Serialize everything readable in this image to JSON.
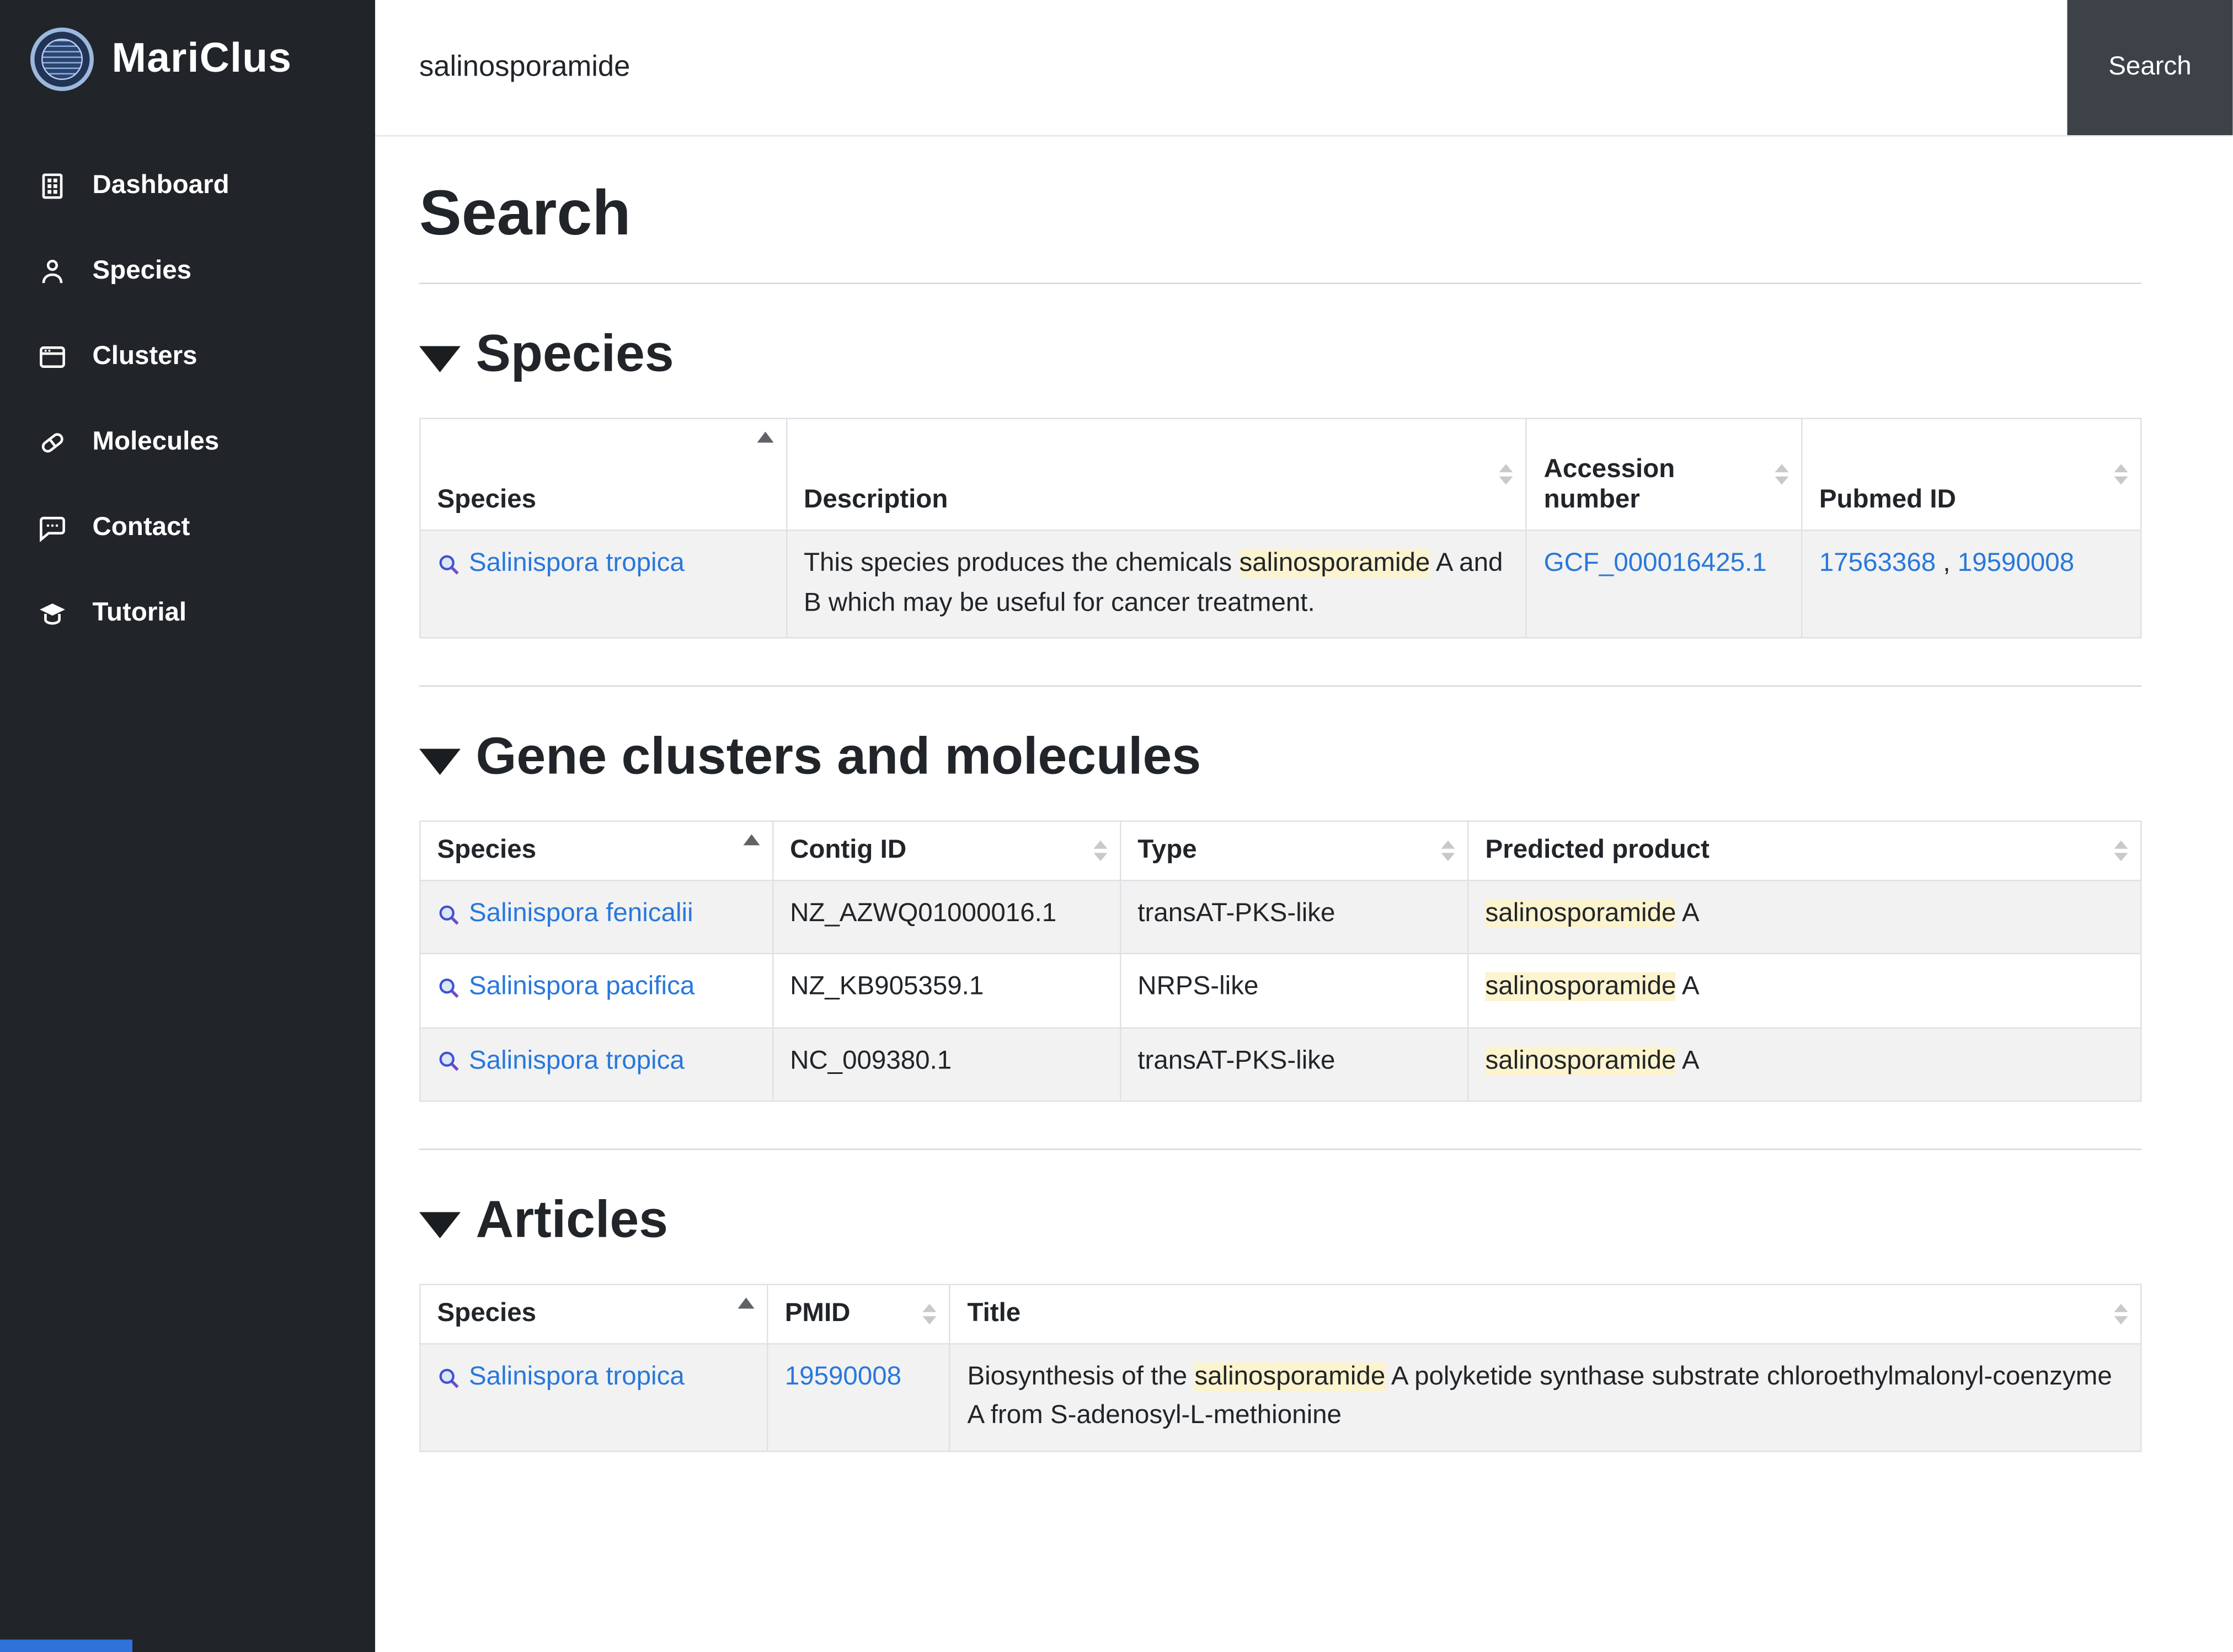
{
  "app": {
    "brand": "MariClus",
    "topbar": {
      "search_value": "salinosporamide",
      "search_button_label": "Search"
    }
  },
  "sidebar": {
    "items": [
      {
        "label": "Dashboard"
      },
      {
        "label": "Species"
      },
      {
        "label": "Clusters"
      },
      {
        "label": "Molecules"
      },
      {
        "label": "Contact"
      },
      {
        "label": "Tutorial"
      }
    ]
  },
  "page": {
    "title": "Search"
  },
  "sections": {
    "species": {
      "title": "Species",
      "columns": [
        "Species",
        "Description",
        "Accession number",
        "Pubmed ID"
      ],
      "rows": [
        {
          "species": "Salinispora tropica",
          "description": [
            "This species produces the chemicals ",
            "salinosporamide",
            " A and B which may be useful for cancer treatment."
          ],
          "accession": "GCF_000016425.1",
          "pubmed": [
            "17563368",
            "19590008"
          ],
          "pubmed_sep": " , "
        }
      ]
    },
    "gene_clusters": {
      "title": "Gene clusters and molecules",
      "columns": [
        "Species",
        "Contig ID",
        "Type",
        "Predicted product"
      ],
      "rows": [
        {
          "species": "Salinispora fenicalii",
          "contig_id": "NZ_AZWQ01000016.1",
          "type": "transAT-PKS-like",
          "product": [
            "salinosporamide",
            " A"
          ]
        },
        {
          "species": "Salinispora pacifica",
          "contig_id": "NZ_KB905359.1",
          "type": "NRPS-like",
          "product": [
            "salinosporamide",
            " A"
          ]
        },
        {
          "species": "Salinispora tropica",
          "contig_id": "NC_009380.1",
          "type": "transAT-PKS-like",
          "product": [
            "salinosporamide",
            " A"
          ]
        }
      ]
    },
    "articles": {
      "title": "Articles",
      "columns": [
        "Species",
        "PMID",
        "Title"
      ],
      "rows": [
        {
          "species": "Salinispora tropica",
          "pmid": "19590008",
          "title": [
            "Biosynthesis of the ",
            "salinosporamide",
            " A polyketide synthase substrate chloroethylmalonyl-coenzyme A from S-adenosyl-L-methionine"
          ]
        }
      ]
    }
  }
}
